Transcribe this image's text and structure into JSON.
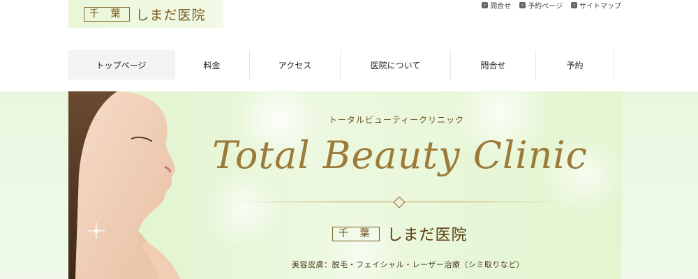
{
  "header": {
    "logo_box": "千 葉",
    "logo_name": "しまだ医院",
    "util_links": [
      {
        "label": "問合せ"
      },
      {
        "label": "予約ページ"
      },
      {
        "label": "サイトマップ"
      }
    ]
  },
  "nav": {
    "items": [
      {
        "label": "トップページ",
        "active": true
      },
      {
        "label": "料金"
      },
      {
        "label": "アクセス"
      },
      {
        "label": "医院について"
      },
      {
        "label": "問合せ"
      },
      {
        "label": "予約"
      }
    ]
  },
  "hero": {
    "subtitle": "トータルビューティークリニック",
    "script_title": "Total Beauty Clinic",
    "clinic_box": "千 葉",
    "clinic_name": "しまだ医院",
    "services": "美容皮膚：脱毛・フェイシャル・レーザー治療（シミ取りなど）"
  },
  "colors": {
    "gold": "#9c7a3a",
    "nav_active_bg": "#f3f3f3",
    "hero_bg": "#e9f7e0"
  }
}
